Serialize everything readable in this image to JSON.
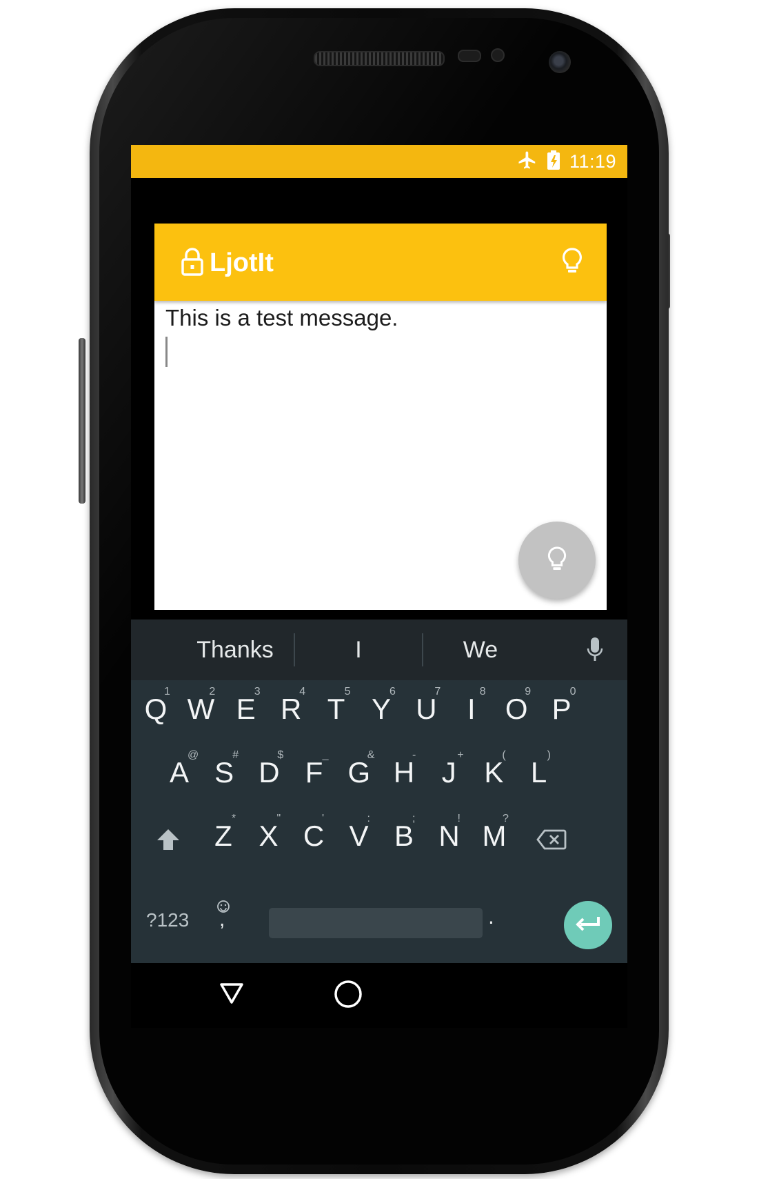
{
  "status_bar": {
    "time": "11:19",
    "icons": [
      "airplane-mode-icon",
      "battery-charging-icon"
    ],
    "color": "#f4b710"
  },
  "app": {
    "title": "LjotIt",
    "toolbar_color": "#fcc10f",
    "lock_icon": "lock-icon",
    "action_icon": "lightbulb-icon"
  },
  "editor": {
    "text": "This is a test message."
  },
  "fab": {
    "icon": "lightbulb-icon",
    "color": "#c2c2c2"
  },
  "keyboard": {
    "suggestions": [
      "Thanks",
      "I",
      "We"
    ],
    "row1": [
      {
        "key": "Q",
        "hint": "1"
      },
      {
        "key": "W",
        "hint": "2"
      },
      {
        "key": "E",
        "hint": "3"
      },
      {
        "key": "R",
        "hint": "4"
      },
      {
        "key": "T",
        "hint": "5"
      },
      {
        "key": "Y",
        "hint": "6"
      },
      {
        "key": "U",
        "hint": "7"
      },
      {
        "key": "I",
        "hint": "8"
      },
      {
        "key": "O",
        "hint": "9"
      },
      {
        "key": "P",
        "hint": "0"
      }
    ],
    "row2": [
      {
        "key": "A",
        "hint": "@"
      },
      {
        "key": "S",
        "hint": "#"
      },
      {
        "key": "D",
        "hint": "$"
      },
      {
        "key": "F",
        "hint": "_"
      },
      {
        "key": "G",
        "hint": "&"
      },
      {
        "key": "H",
        "hint": "-"
      },
      {
        "key": "J",
        "hint": "+"
      },
      {
        "key": "K",
        "hint": "("
      },
      {
        "key": "L",
        "hint": ")"
      }
    ],
    "row3": [
      {
        "key": "Z",
        "hint": "*"
      },
      {
        "key": "X",
        "hint": "\""
      },
      {
        "key": "C",
        "hint": "'"
      },
      {
        "key": "V",
        "hint": ":"
      },
      {
        "key": "B",
        "hint": ";"
      },
      {
        "key": "N",
        "hint": "!"
      },
      {
        "key": "M",
        "hint": "?"
      }
    ],
    "symbols_label": "?123",
    "comma_label": ",",
    "period_label": ".",
    "enter_color": "#6fcbb8",
    "background": "#263238"
  },
  "navigation": {
    "back": "back-triangle-icon",
    "home": "home-circle-icon"
  }
}
